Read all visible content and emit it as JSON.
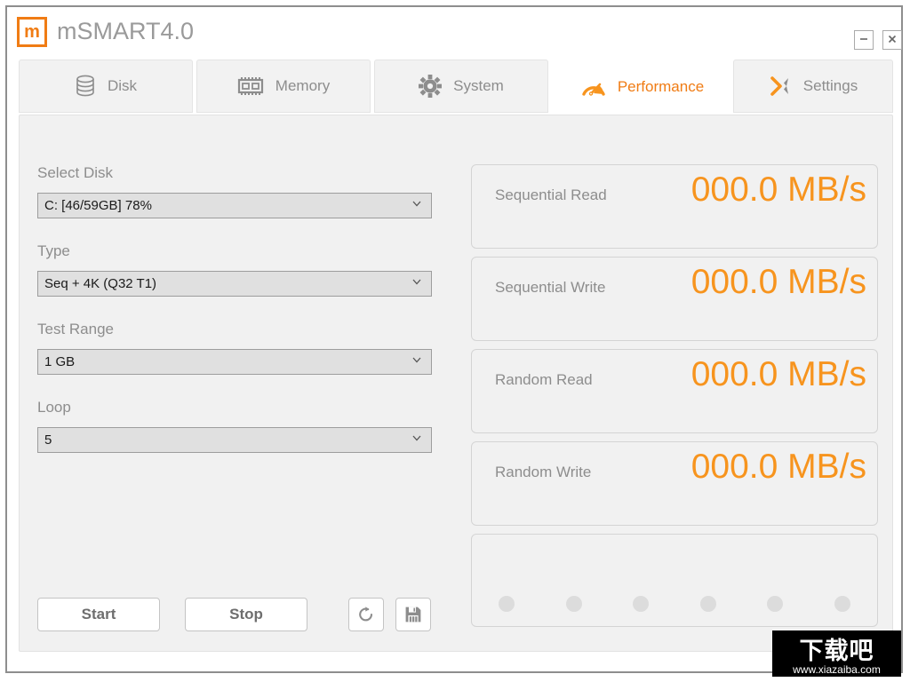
{
  "window": {
    "title": "mSMART4.0",
    "logo_letter": "m",
    "minimize_label": "–",
    "close_label": "✕",
    "accent_color": "#f07c14",
    "value_color": "#f7941e"
  },
  "tabs": [
    {
      "id": "disk",
      "label": "Disk",
      "icon": "disk-icon",
      "active": false
    },
    {
      "id": "memory",
      "label": "Memory",
      "icon": "memory-icon",
      "active": false
    },
    {
      "id": "system",
      "label": "System",
      "icon": "gear-icon",
      "active": false
    },
    {
      "id": "performance",
      "label": "Performance",
      "icon": "speedometer-icon",
      "active": true
    },
    {
      "id": "settings",
      "label": "Settings",
      "icon": "tools-x-icon",
      "active": false
    }
  ],
  "settings": {
    "fields": [
      {
        "id": "select-disk",
        "label": "Select Disk",
        "value": "C: [46/59GB] 78%"
      },
      {
        "id": "type",
        "label": "Type",
        "value": "Seq + 4K (Q32 T1)"
      },
      {
        "id": "test-range",
        "label": "Test Range",
        "value": "1 GB"
      },
      {
        "id": "loop",
        "label": "Loop",
        "value": "5"
      }
    ]
  },
  "actions": {
    "start_label": "Start",
    "stop_label": "Stop",
    "refresh_icon": "refresh-icon",
    "save_icon": "save-icon"
  },
  "results": {
    "cards": [
      {
        "id": "sequential-read",
        "label": "Sequential Read",
        "value": "000.0 MB/s"
      },
      {
        "id": "sequential-write",
        "label": "Sequential Write",
        "value": "000.0 MB/s"
      },
      {
        "id": "random-read",
        "label": "Random Read",
        "value": "000.0 MB/s"
      },
      {
        "id": "random-write",
        "label": "Random Write",
        "value": "000.0 MB/s"
      }
    ],
    "progress_dots": 6
  },
  "watermark": {
    "text": "下载吧",
    "url": "www.xiazaiba.com"
  }
}
